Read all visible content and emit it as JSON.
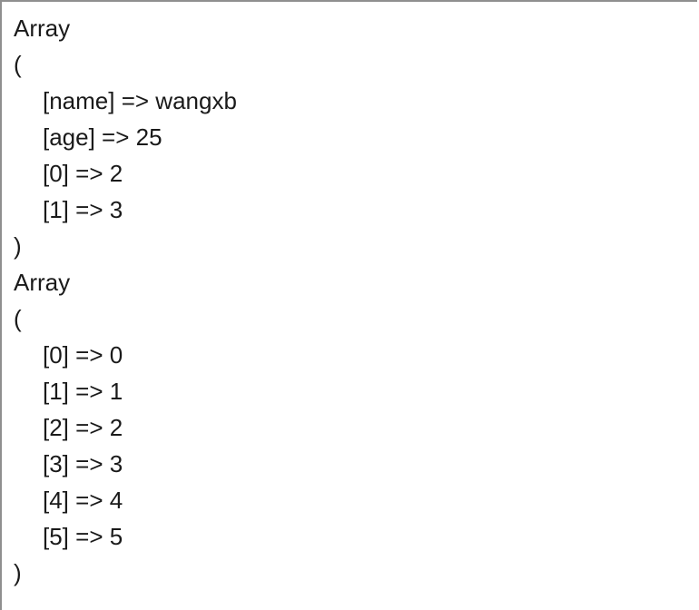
{
  "output": {
    "arrays": [
      {
        "header": "Array",
        "open": "(",
        "entries": [
          "[name] => wangxb",
          "[age] => 25",
          "[0] => 2",
          "[1] => 3"
        ],
        "close": ")"
      },
      {
        "header": "Array",
        "open": "(",
        "entries": [
          "[0] => 0",
          "[1] => 1",
          "[2] => 2",
          "[3] => 3",
          "[4] => 4",
          "[5] => 5"
        ],
        "close": ")"
      }
    ]
  }
}
